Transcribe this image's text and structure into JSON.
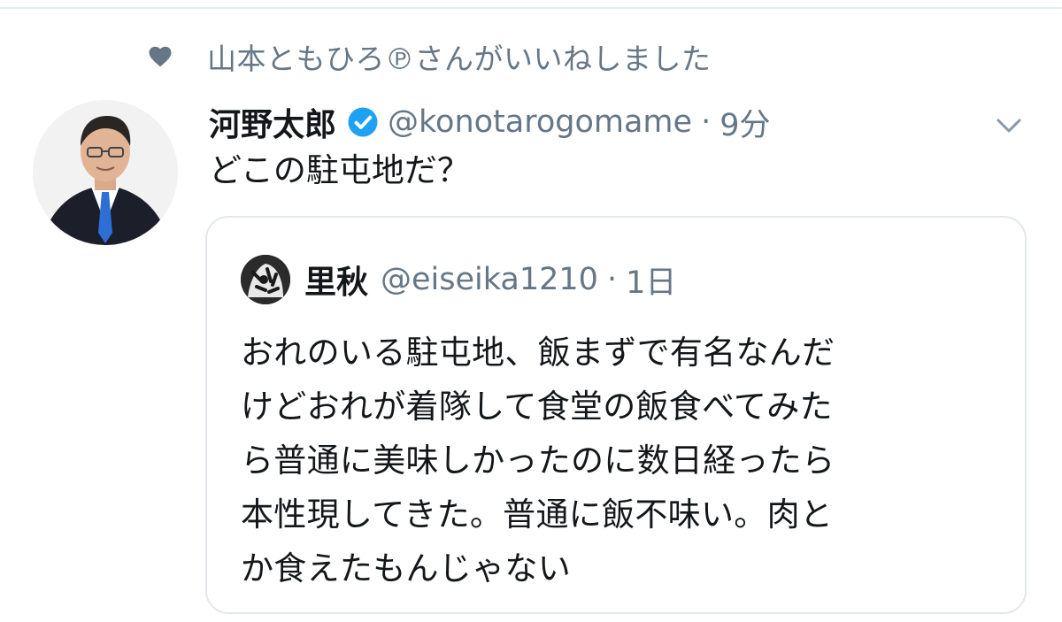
{
  "social_context": {
    "text": "山本ともひろ℗さんがいいねしました",
    "icon": "heart-icon"
  },
  "tweet": {
    "display_name": "河野太郎",
    "verified": true,
    "handle": "@konotarogomame",
    "separator": "·",
    "timestamp": "9分",
    "text": "どこの駐屯地だ？",
    "menu_icon": "chevron-down-icon"
  },
  "quoted_tweet": {
    "display_name": "里秋",
    "handle": "@eiseika1210",
    "separator": "·",
    "timestamp": "1日",
    "lines": [
      "おれのいる駐屯地、飯まずで有名なんだ",
      "けどおれが着隊して食堂の飯食べてみた",
      "ら普通に美味しかったのに数日経ったら",
      "本性現してきた。普通に飯不味い。肉と",
      "か食えたもんじゃない"
    ]
  },
  "colors": {
    "text_primary": "#14171a",
    "text_secondary": "#657786",
    "verified_blue": "#1da1f2",
    "border": "#e1e8ed"
  }
}
